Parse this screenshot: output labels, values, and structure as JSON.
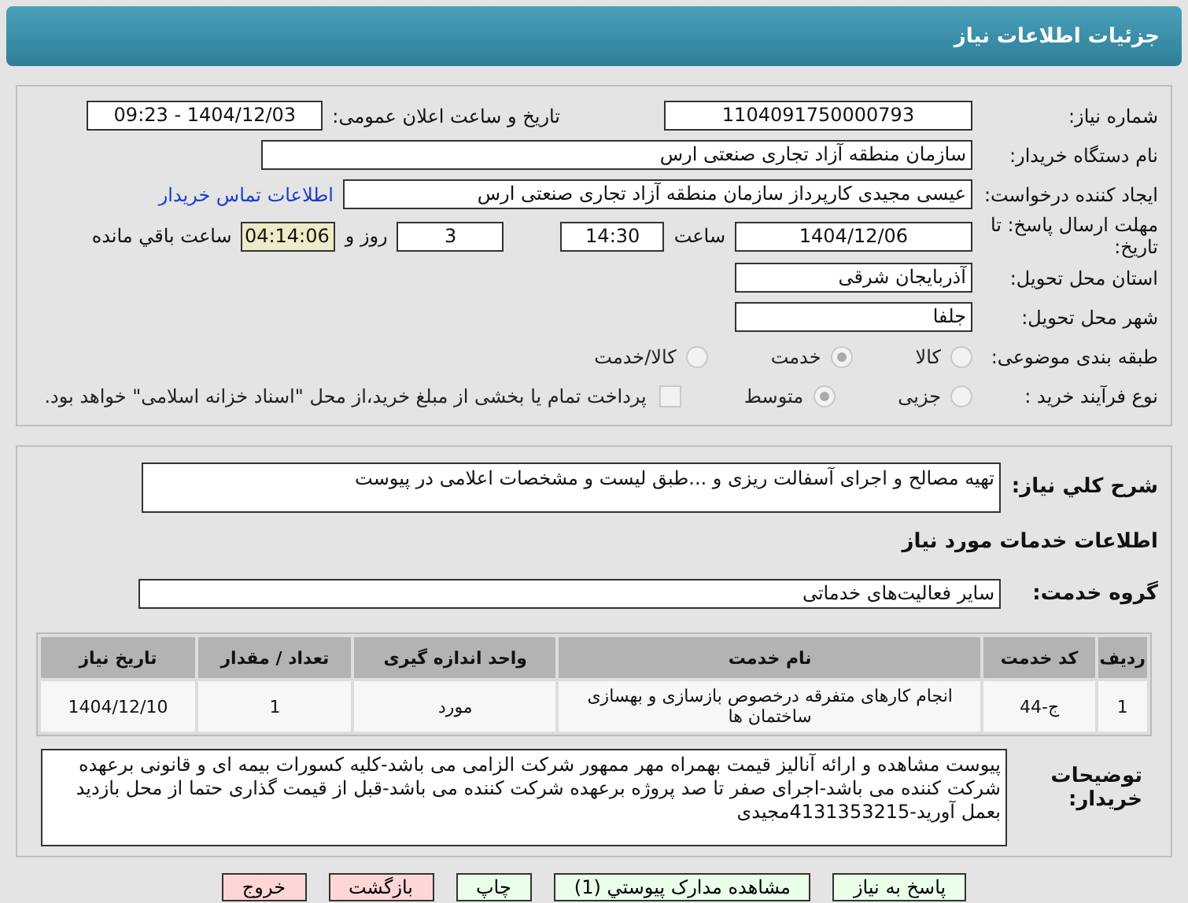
{
  "header": {
    "title": "جزئیات اطلاعات نیاز"
  },
  "info": {
    "need_number": {
      "label": "شماره نیاز:",
      "value": "1104091750000793"
    },
    "announce": {
      "label": "تاریخ و ساعت اعلان عمومی:",
      "value": "1404/12/03 - 09:23"
    },
    "buyer": {
      "label": "نام دستگاه خریدار:",
      "value": "سازمان منطقه آزاد تجاری صنعتی ارس"
    },
    "creator": {
      "label": "ایجاد کننده درخواست:",
      "value": "عیسی مجیدی کارپرداز سازمان منطقه آزاد تجاری صنعتی ارس",
      "link": "اطلاعات تماس خریدار"
    },
    "deadline": {
      "label": "مهلت ارسال پاسخ: تا تاریخ:",
      "date": "1404/12/06",
      "time_label": "ساعت",
      "time": "14:30",
      "days": "3",
      "days_label": "روز و",
      "remaining": "04:14:06",
      "remaining_label": "ساعت باقي مانده"
    },
    "province": {
      "label": "استان محل تحویل:",
      "value": "آذربایجان شرقی"
    },
    "city": {
      "label": "شهر محل تحویل:",
      "value": "جلفا"
    },
    "category": {
      "label": "طبقه بندی موضوعی:",
      "options": [
        {
          "label": "کالا",
          "selected": false
        },
        {
          "label": "خدمت",
          "selected": true
        },
        {
          "label": "کالا/خدمت",
          "selected": false
        }
      ]
    },
    "process": {
      "label": "نوع فرآیند خرید :",
      "options": [
        {
          "label": "جزیی",
          "selected": false
        },
        {
          "label": "متوسط",
          "selected": true
        }
      ],
      "payment": {
        "label": "پرداخت تمام یا بخشی از مبلغ خرید،از محل \"اسناد خزانه اسلامی\" خواهد بود.",
        "checked": false
      }
    }
  },
  "details": {
    "summary": {
      "label": "شرح کلي نیاز:",
      "value": "تهیه مصالح و اجرای آسفالت ریزی و ...طبق لیست و مشخصات اعلامی در پیوست"
    },
    "services_heading": "اطلاعات خدمات مورد نیاز",
    "group": {
      "label": "گروه خدمت:",
      "value": "سایر فعالیت‌های خدماتی"
    },
    "table": {
      "columns": [
        "ردیف",
        "کد خدمت",
        "نام خدمت",
        "واحد اندازه گیری",
        "تعداد / مقدار",
        "تاریخ نیاز"
      ],
      "rows": [
        [
          "1",
          "ج-44",
          "انجام کارهای متفرقه درخصوص بازسازی و بهسازی ساختمان ها",
          "مورد",
          "1",
          "1404/12/10"
        ]
      ]
    },
    "notes": {
      "label": "توضیحات خریدار:",
      "value": "پیوست مشاهده و ارائه آنالیز قیمت بهمراه مهر ممهور شرکت الزامی می باشد-کلیه کسورات بیمه ای و قانونی برعهده شرکت کننده می باشد-اجرای صفر تا صد پروژه برعهده شرکت کننده می باشد-قبل از قیمت گذاری حتما از محل بازدید بعمل آورید-4131353215مجیدی"
    }
  },
  "buttons": [
    {
      "label": "پاسخ به نیاز",
      "kind": "primary"
    },
    {
      "label": "مشاهده مدارک پیوستي (1)",
      "kind": "primary"
    },
    {
      "label": "چاپ",
      "kind": "primary"
    },
    {
      "label": "بازگشت",
      "kind": "danger"
    },
    {
      "label": "خروج",
      "kind": "danger"
    }
  ]
}
